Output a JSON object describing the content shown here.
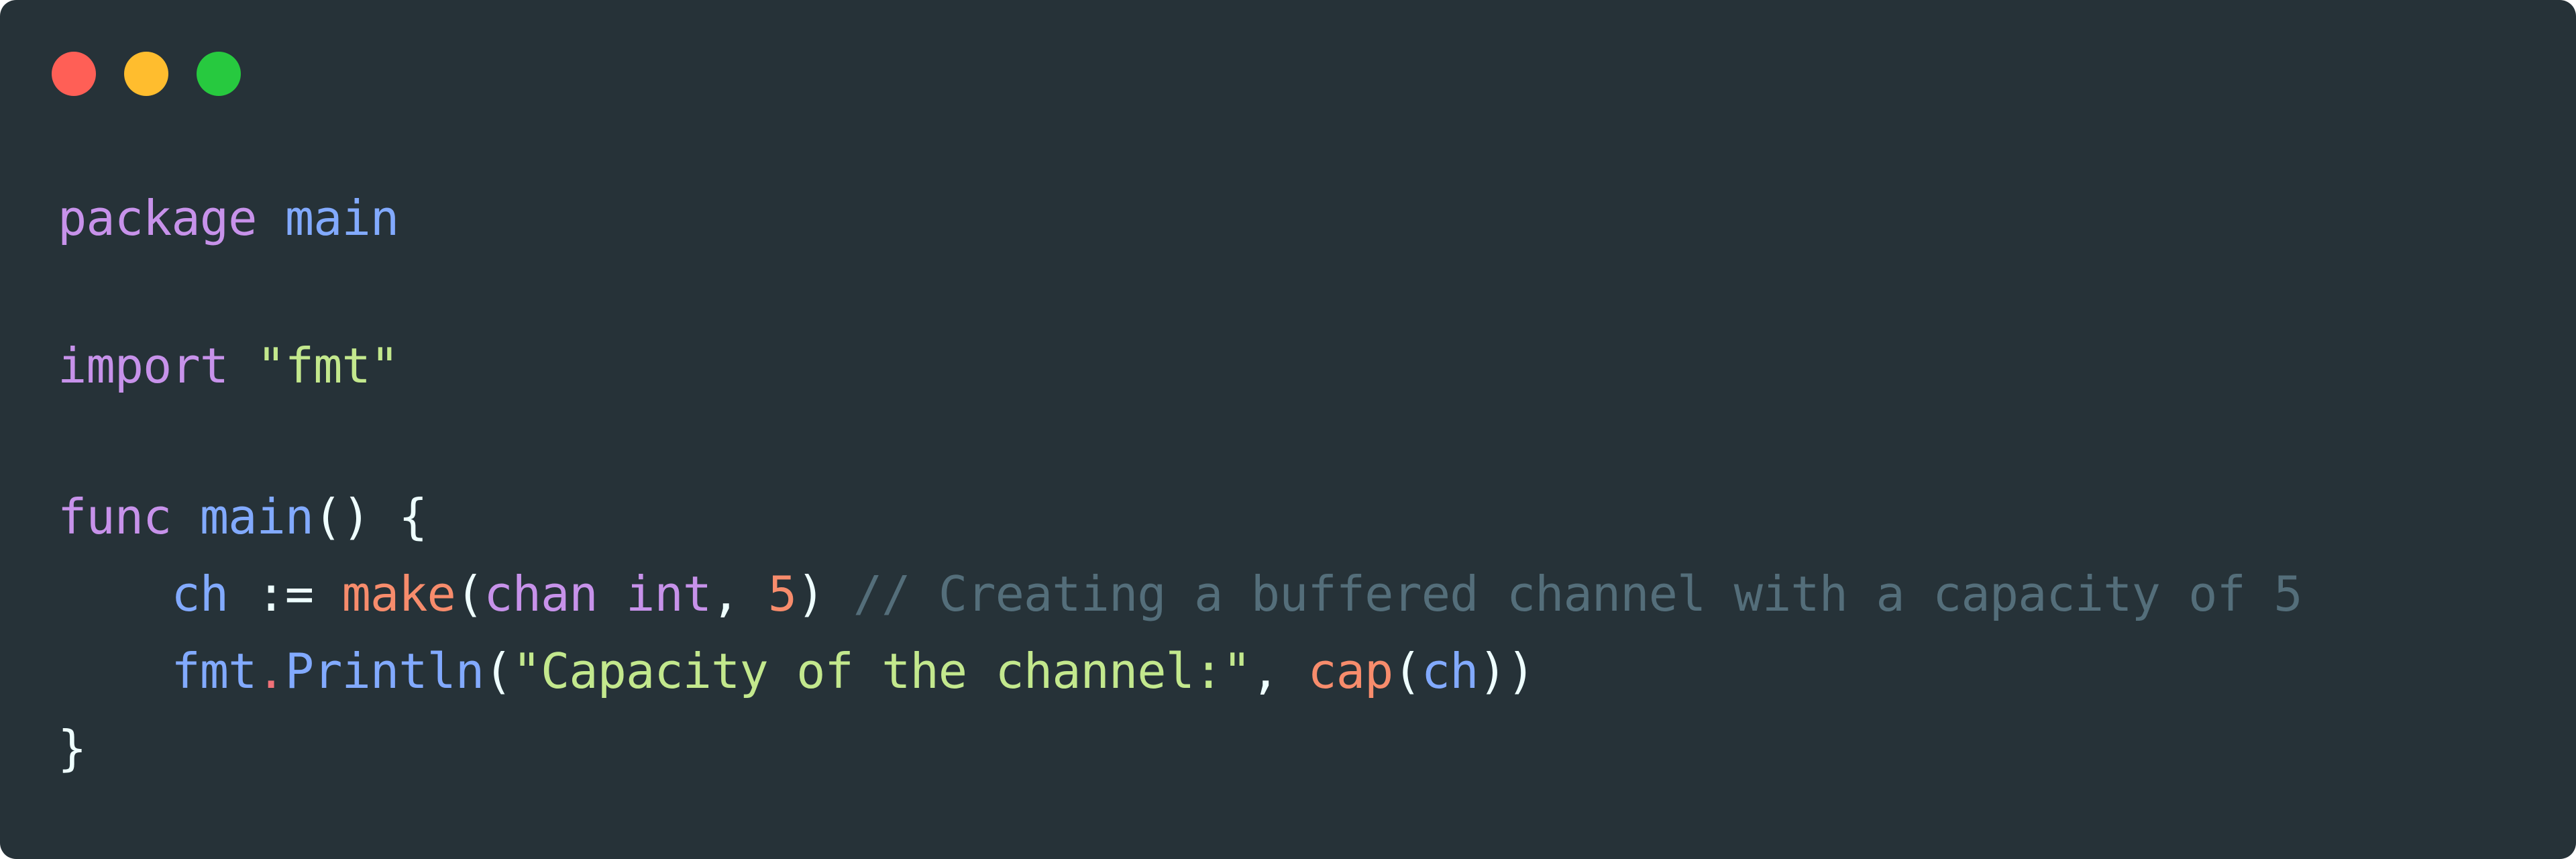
{
  "window": {
    "controls": [
      "close",
      "minimize",
      "maximize"
    ],
    "background": "#263238"
  },
  "code": {
    "language": "go",
    "lines": [
      {
        "tokens": [
          {
            "t": "package",
            "c": "kw"
          },
          {
            "t": " ",
            "c": "punc"
          },
          {
            "t": "main",
            "c": "id"
          }
        ]
      },
      {
        "tokens": []
      },
      {
        "tokens": [
          {
            "t": "import",
            "c": "kw"
          },
          {
            "t": " ",
            "c": "punc"
          },
          {
            "t": "\"fmt\"",
            "c": "str"
          }
        ]
      },
      {
        "tokens": []
      },
      {
        "tokens": [
          {
            "t": "func",
            "c": "kw"
          },
          {
            "t": " ",
            "c": "punc"
          },
          {
            "t": "main",
            "c": "id"
          },
          {
            "t": "() {",
            "c": "punc"
          }
        ]
      },
      {
        "tokens": [
          {
            "t": "    ",
            "c": "punc"
          },
          {
            "t": "ch",
            "c": "id"
          },
          {
            "t": " ",
            "c": "punc"
          },
          {
            "t": ":=",
            "c": "punc"
          },
          {
            "t": " ",
            "c": "punc"
          },
          {
            "t": "make",
            "c": "fn"
          },
          {
            "t": "(",
            "c": "punc"
          },
          {
            "t": "chan",
            "c": "kw"
          },
          {
            "t": " ",
            "c": "punc"
          },
          {
            "t": "int",
            "c": "kw"
          },
          {
            "t": ", ",
            "c": "punc"
          },
          {
            "t": "5",
            "c": "num"
          },
          {
            "t": ") ",
            "c": "punc"
          },
          {
            "t": "// Creating a buffered channel with a capacity of 5",
            "c": "cmt"
          }
        ]
      },
      {
        "tokens": [
          {
            "t": "    ",
            "c": "punc"
          },
          {
            "t": "fmt",
            "c": "id"
          },
          {
            "t": ".",
            "c": "dotop"
          },
          {
            "t": "Println",
            "c": "id"
          },
          {
            "t": "(",
            "c": "punc"
          },
          {
            "t": "\"Capacity of the channel:\"",
            "c": "str"
          },
          {
            "t": ", ",
            "c": "punc"
          },
          {
            "t": "cap",
            "c": "fn"
          },
          {
            "t": "(",
            "c": "punc"
          },
          {
            "t": "ch",
            "c": "id"
          },
          {
            "t": "))",
            "c": "punc"
          }
        ]
      },
      {
        "tokens": [
          {
            "t": "}",
            "c": "punc"
          }
        ]
      }
    ]
  }
}
